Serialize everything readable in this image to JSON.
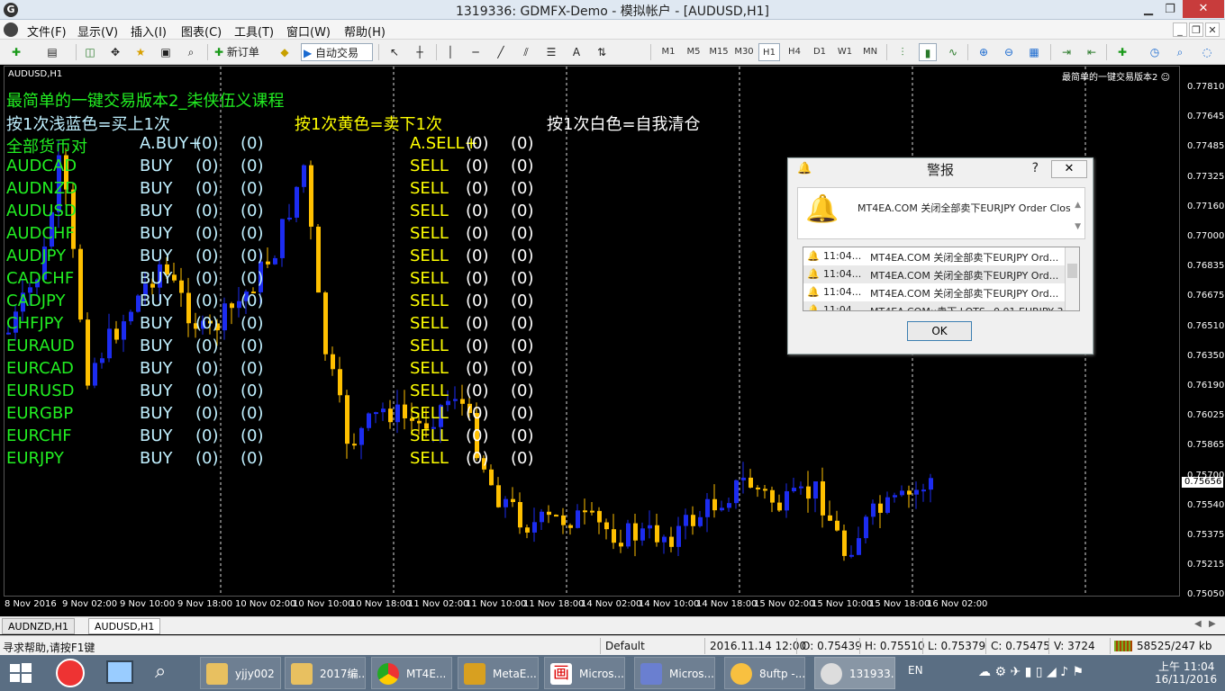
{
  "window": {
    "title": "1319336: GDMFX-Demo - 模拟帐户 - [AUDUSD,H1]",
    "app_icon": "G",
    "min": "▁",
    "restore": "❐",
    "close": "✕"
  },
  "menu": {
    "items": [
      "文件(F)",
      "显示(V)",
      "插入(I)",
      "图表(C)",
      "工具(T)",
      "窗口(W)",
      "帮助(H)"
    ],
    "mdi": [
      "_",
      "❐",
      "✕"
    ]
  },
  "toolbar": {
    "new_order": "新订单",
    "auto_trade": "自动交易",
    "timeframes": [
      "M1",
      "M5",
      "M15",
      "M30",
      "H1",
      "H4",
      "D1",
      "W1",
      "MN"
    ],
    "active_tf": "H1",
    "line_text": "A"
  },
  "chart": {
    "label": "AUDUSD,H1",
    "ea_name": "最简单的一键交易版本2 ☺",
    "colors": {
      "bull": "#1c2cf0",
      "bear": "#ffc000",
      "green": "#22ee22",
      "white": "#ffffff",
      "yellow": "#ffff00",
      "cyan": "#c0f0ff"
    },
    "overlay": {
      "title": "最简单的一键交易版本2_柒侠伍义课程",
      "hint_blue": "按1次浅蓝色=买上1次",
      "hint_yellow": "按1次黄色=卖下1次",
      "hint_white": "按1次白色=自我清仓",
      "all_pairs": "全部货币对",
      "all_buy": "A.BUY+",
      "all_sell": "A.SELL+",
      "buy": "BUY",
      "sell": "SELL",
      "zero": "(0)",
      "pairs": [
        "AUDCAD",
        "AUDNZD",
        "AUDUSD",
        "AUDCHF",
        "AUDJPY",
        "CADCHF",
        "CADJPY",
        "CHFJPY",
        "EURAUD",
        "EURCAD",
        "EURUSD",
        "EURGBP",
        "EURCHF",
        "EURJPY"
      ]
    },
    "price_labels": [
      "0.77810",
      "0.77645",
      "0.77485",
      "0.77325",
      "0.77160",
      "0.77000",
      "0.76835",
      "0.76675",
      "0.76510",
      "0.76350",
      "0.76190",
      "0.76025",
      "0.75865",
      "0.75700",
      "0.75540",
      "0.75375",
      "0.75215",
      "0.75050"
    ],
    "current_price": "0.75656",
    "time_labels": [
      "8 Nov 2016",
      "9 Nov 02:00",
      "9 Nov 10:00",
      "9 Nov 18:00",
      "10 Nov 02:00",
      "10 Nov 10:00",
      "10 Nov 18:00",
      "11 Nov 02:00",
      "11 Nov 10:00",
      "11 Nov 18:00",
      "14 Nov 02:00",
      "14 Nov 10:00",
      "14 Nov 18:00",
      "15 Nov 02:00",
      "15 Nov 10:00",
      "15 Nov 18:00",
      "16 Nov 02:00"
    ]
  },
  "dialog": {
    "title": "警报",
    "help": "?",
    "close": "✕",
    "message": "MT4EA.COM 关闭全部卖下EURJPY Order Clos",
    "rows": [
      {
        "time": "11:04...",
        "text": "MT4EA.COM 关闭全部卖下EURJPY Ord..."
      },
      {
        "time": "11:04...",
        "text": "MT4EA.COM 关闭全部卖下EURJPY Ord..."
      },
      {
        "time": "11:04...",
        "text": "MT4EA.COM 关闭全部卖下EURJPY Ord..."
      },
      {
        "time": "11:04...",
        "text": "MT4EA.COM::卖下 LOTS=0.01 EURJPY 3..."
      }
    ],
    "ok": "OK"
  },
  "tabs": [
    "AUDNZD,H1",
    "AUDUSD,H1"
  ],
  "status": {
    "help": "寻求帮助,请按F1键",
    "profile": "Default",
    "datetime": "2016.11.14 12:00",
    "open": "O: 0.75439",
    "high": "H: 0.75510",
    "low": "L: 0.75379",
    "close": "C: 0.75475",
    "volume": "V: 3724",
    "traffic": "58525/247 kb"
  },
  "taskbar": {
    "tasks": [
      "yjjy002",
      "2017编...",
      "MT4E...",
      "MetaE...",
      "Micros...",
      "Micros...",
      "8uftp -...",
      "131933..."
    ],
    "lang": "EN",
    "time": "上午 11:04",
    "date": "16/11/2016"
  }
}
